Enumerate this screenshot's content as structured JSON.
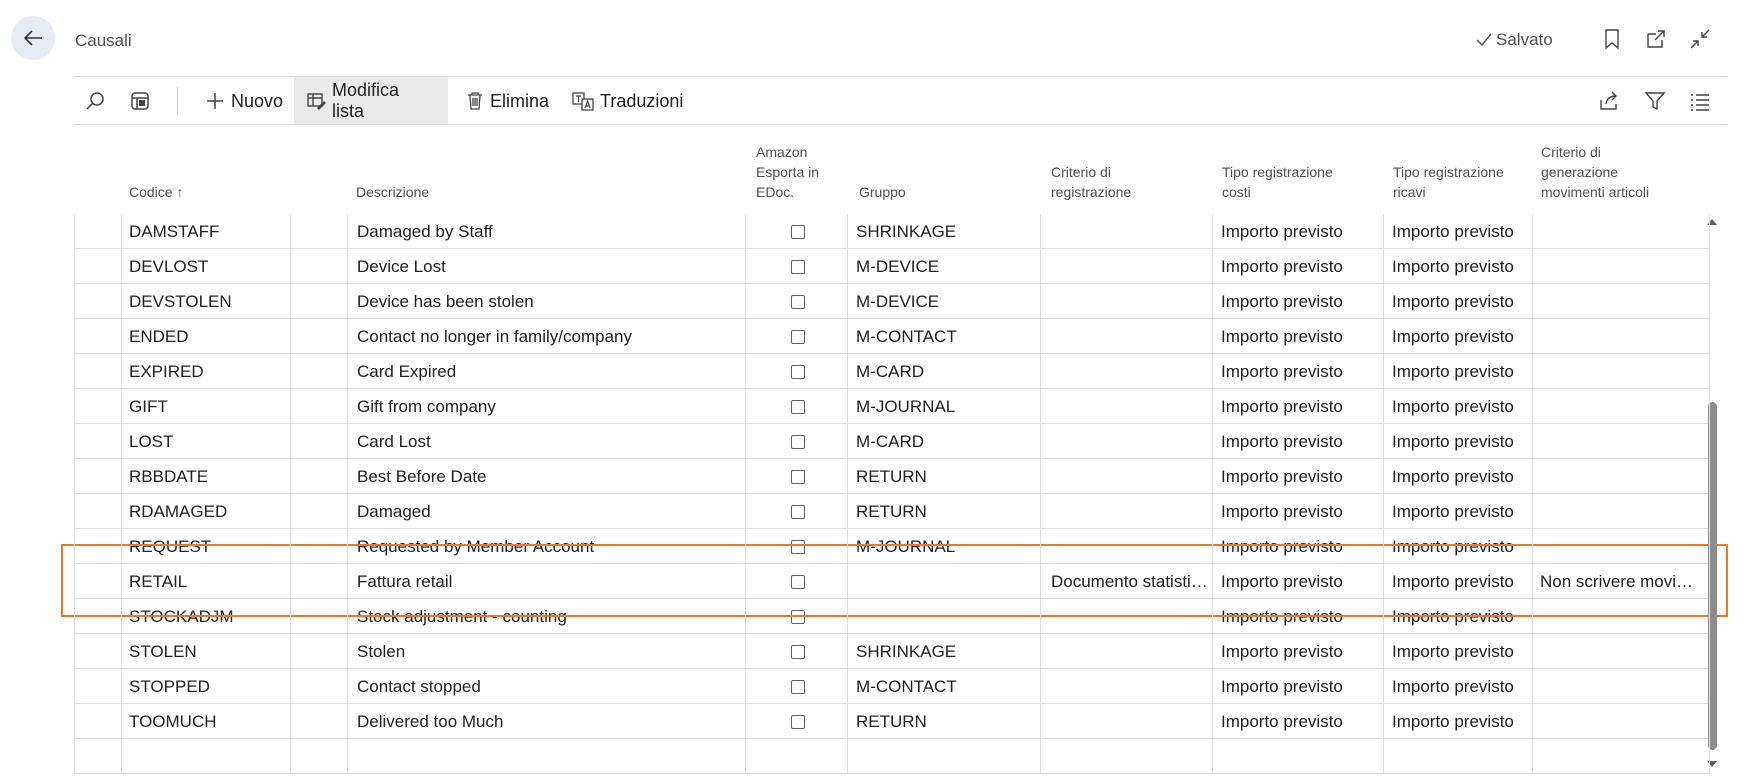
{
  "page": {
    "title": "Causali",
    "saved_label": "Salvato"
  },
  "icons": {
    "back": "arrow-left-icon",
    "bookmark": "bookmark-icon",
    "open_new": "open-in-new-window-icon",
    "collapse": "collapse-icon",
    "search": "search-icon",
    "layout": "layout-icon",
    "share": "share-icon",
    "filter": "filter-icon",
    "list": "list-view-icon"
  },
  "toolbar": {
    "new_label": "Nuovo",
    "edit_list_label": "Modifica lista",
    "delete_label": "Elimina",
    "translations_label": "Traduzioni"
  },
  "columns": {
    "code": "Codice",
    "description": "Descrizione",
    "amazon_1": "Amazon",
    "amazon_2": "Esporta in",
    "amazon_3": "EDoc.",
    "group": "Gruppo",
    "reg_crit_1": "Criterio di",
    "reg_crit_2": "registrazione",
    "cost_1": "Tipo registrazione",
    "cost_2": "costi",
    "rev_1": "Tipo registrazione",
    "rev_2": "ricavi",
    "item_1": "Criterio di",
    "item_2": "generazione",
    "item_3": "movimenti articoli"
  },
  "rows": [
    {
      "code": "DAMSTAFF",
      "description": "Damaged by Staff",
      "group": "SHRINKAGE",
      "reg_criteria": "",
      "cost_type": "Importo previsto",
      "revenue_type": "Importo previsto",
      "item_criteria": ""
    },
    {
      "code": "DEVLOST",
      "description": "Device Lost",
      "group": "M-DEVICE",
      "reg_criteria": "",
      "cost_type": "Importo previsto",
      "revenue_type": "Importo previsto",
      "item_criteria": ""
    },
    {
      "code": "DEVSTOLEN",
      "description": "Device has been stolen",
      "group": "M-DEVICE",
      "reg_criteria": "",
      "cost_type": "Importo previsto",
      "revenue_type": "Importo previsto",
      "item_criteria": ""
    },
    {
      "code": "ENDED",
      "description": "Contact no longer in family/company",
      "group": "M-CONTACT",
      "reg_criteria": "",
      "cost_type": "Importo previsto",
      "revenue_type": "Importo previsto",
      "item_criteria": ""
    },
    {
      "code": "EXPIRED",
      "description": "Card Expired",
      "group": "M-CARD",
      "reg_criteria": "",
      "cost_type": "Importo previsto",
      "revenue_type": "Importo previsto",
      "item_criteria": ""
    },
    {
      "code": "GIFT",
      "description": "Gift from company",
      "group": "M-JOURNAL",
      "reg_criteria": "",
      "cost_type": "Importo previsto",
      "revenue_type": "Importo previsto",
      "item_criteria": ""
    },
    {
      "code": "LOST",
      "description": "Card Lost",
      "group": "M-CARD",
      "reg_criteria": "",
      "cost_type": "Importo previsto",
      "revenue_type": "Importo previsto",
      "item_criteria": ""
    },
    {
      "code": "RBBDATE",
      "description": "Best Before Date",
      "group": "RETURN",
      "reg_criteria": "",
      "cost_type": "Importo previsto",
      "revenue_type": "Importo previsto",
      "item_criteria": ""
    },
    {
      "code": "RDAMAGED",
      "description": "Damaged",
      "group": "RETURN",
      "reg_criteria": "",
      "cost_type": "Importo previsto",
      "revenue_type": "Importo previsto",
      "item_criteria": ""
    },
    {
      "code": "REQUEST",
      "description": "Requested by Member Account",
      "group": "M-JOURNAL",
      "reg_criteria": "",
      "cost_type": "Importo previsto",
      "revenue_type": "Importo previsto",
      "item_criteria": ""
    },
    {
      "code": "RETAIL",
      "description": "Fattura retail",
      "group": "",
      "reg_criteria": "Documento statisti…",
      "cost_type": "Importo previsto",
      "revenue_type": "Importo previsto",
      "item_criteria": "Non scrivere movi…"
    },
    {
      "code": "STOCKADJM",
      "description": "Stock adjustment - counting",
      "group": "",
      "reg_criteria": "",
      "cost_type": "Importo previsto",
      "revenue_type": "Importo previsto",
      "item_criteria": ""
    },
    {
      "code": "STOLEN",
      "description": "Stolen",
      "group": "SHRINKAGE",
      "reg_criteria": "",
      "cost_type": "Importo previsto",
      "revenue_type": "Importo previsto",
      "item_criteria": ""
    },
    {
      "code": "STOPPED",
      "description": "Contact stopped",
      "group": "M-CONTACT",
      "reg_criteria": "",
      "cost_type": "Importo previsto",
      "revenue_type": "Importo previsto",
      "item_criteria": ""
    },
    {
      "code": "TOOMUCH",
      "description": "Delivered too Much",
      "group": "RETURN",
      "reg_criteria": "",
      "cost_type": "Importo previsto",
      "revenue_type": "Importo previsto",
      "item_criteria": ""
    },
    {
      "code": "",
      "description": "",
      "group": "",
      "reg_criteria": "",
      "cost_type": "",
      "revenue_type": "",
      "item_criteria": ""
    }
  ],
  "colors": {
    "highlight": "#e87a2d",
    "grid_line": "#e1e1e1",
    "back_button_bg": "#e7ecf3"
  }
}
